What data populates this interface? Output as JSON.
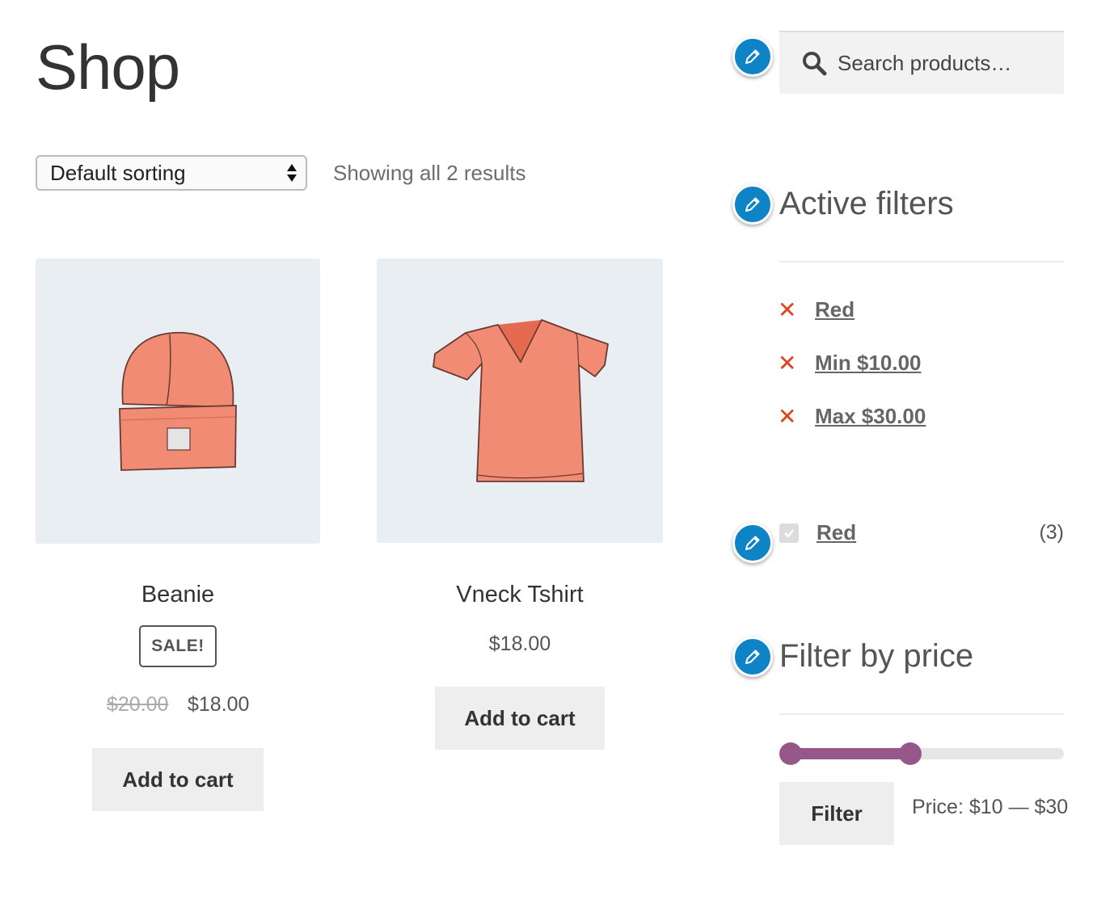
{
  "page": {
    "title": "Shop"
  },
  "toolbar": {
    "sort_label": "Default sorting",
    "result_count": "Showing all 2 results"
  },
  "products": [
    {
      "name": "Beanie",
      "badge": "SALE!",
      "old_price": "$20.00",
      "price": "$18.00",
      "button": "Add to cart",
      "image": "beanie-illustration"
    },
    {
      "name": "Vneck Tshirt",
      "price": "$18.00",
      "button": "Add to cart",
      "image": "vneck-tshirt-illustration"
    }
  ],
  "sidebar": {
    "search": {
      "placeholder": "Search products…"
    },
    "active_filters": {
      "title": "Active filters",
      "items": [
        {
          "label": "Red"
        },
        {
          "label": "Min $10.00"
        },
        {
          "label": "Max $30.00"
        }
      ]
    },
    "layered_nav": {
      "label": "Red",
      "count": "(3)",
      "checked": true
    },
    "price_filter": {
      "title": "Filter by price",
      "button": "Filter",
      "price_text": "Price: $10 — $30",
      "range_min": 10,
      "range_max": 30
    }
  },
  "colors": {
    "accent": "#96588a",
    "remove": "#e2401c",
    "edit_icon": "#0e84c7",
    "product_bg": "#e9eef3",
    "product_color": "#f28b74"
  },
  "icons": [
    "search-icon",
    "pencil-icon",
    "remove-icon",
    "checkbox-icon",
    "select-arrows-icon"
  ]
}
